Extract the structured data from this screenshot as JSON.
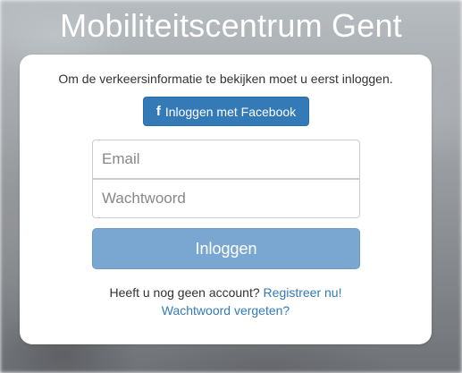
{
  "page": {
    "title": "Mobiliteitscentrum Gent"
  },
  "login": {
    "intro": "Om de verkeersinformatie te bekijken moet u eerst inloggen.",
    "facebook_icon": "f",
    "facebook_label": "Inloggen met Facebook",
    "email_placeholder": "Email",
    "password_placeholder": "Wachtwoord",
    "submit_label": "Inloggen",
    "no_account_text": "Heeft u nog geen account?",
    "register_link": "Registreer nu!",
    "forgot_link": "Wachtwoord vergeten?"
  },
  "colors": {
    "primary": "#337ab7",
    "login_button": "#7aa7d2"
  }
}
